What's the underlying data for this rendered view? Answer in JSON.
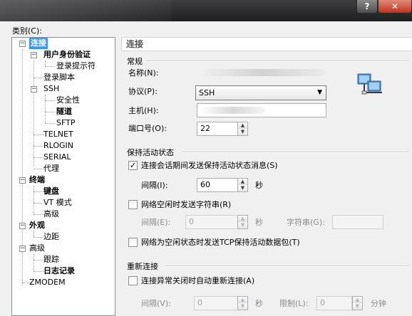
{
  "window": {
    "help_label": "?",
    "close_label": "✕"
  },
  "category_label": "类别(C):",
  "tree": [
    {
      "label": "连接",
      "bold": true,
      "selected": true,
      "toggle": "−"
    },
    {
      "label": "用户身份验证",
      "bold": true,
      "toggle": "−"
    },
    {
      "label": "登录提示符"
    },
    {
      "label": "登录脚本"
    },
    {
      "label": "SSH",
      "toggle": "−"
    },
    {
      "label": "安全性"
    },
    {
      "label": "隧道",
      "bold": true
    },
    {
      "label": "SFTP"
    },
    {
      "label": "TELNET"
    },
    {
      "label": "RLOGIN"
    },
    {
      "label": "SERIAL"
    },
    {
      "label": "代理"
    },
    {
      "label": "终端",
      "bold": true,
      "toggle": "−"
    },
    {
      "label": "键盘",
      "bold": true
    },
    {
      "label": "VT 模式"
    },
    {
      "label": "高级"
    },
    {
      "label": "外观",
      "bold": true,
      "toggle": "−"
    },
    {
      "label": "边距"
    },
    {
      "label": "高级",
      "toggle": "−"
    },
    {
      "label": "跟踪"
    },
    {
      "label": "日志记录",
      "bold": true
    },
    {
      "label": "ZMODEM"
    }
  ],
  "panel": {
    "header": "连接",
    "general": {
      "title": "常规",
      "name_label": "名称(N):",
      "name_value": "",
      "protocol_label": "协议(P):",
      "protocol_value": "SSH",
      "host_label": "主机(H):",
      "host_value": "",
      "port_label": "端口号(O):",
      "port_value": "22"
    },
    "keepalive": {
      "title": "保持活动状态",
      "send_keepalive_label": "连接会话期间发送保持活动状态消息(S)",
      "send_keepalive_checked": true,
      "interval_label": "间隔(I):",
      "interval_value": "60",
      "seconds_label": "秒",
      "send_string_label": "网络空闲时发送字符串(R)",
      "send_string_checked": false,
      "interval2_label": "间隔(E):",
      "interval2_value": "0",
      "seconds2_label": "秒",
      "string_label": "字符串(G):",
      "string_value": "",
      "tcp_keepalive_label": "网络为空闲状态时发送TCP保持活动数据包(T)",
      "tcp_keepalive_checked": false
    },
    "reconnect": {
      "title": "重新连接",
      "auto_reconnect_label": "连接异常关闭时自动重新连接(A)",
      "auto_reconnect_checked": false,
      "interval_label": "间隔(V):",
      "interval_value": "0",
      "seconds_label": "秒",
      "limit_label": "限制(L):",
      "limit_value": "0",
      "minutes_label": "分钟"
    }
  }
}
